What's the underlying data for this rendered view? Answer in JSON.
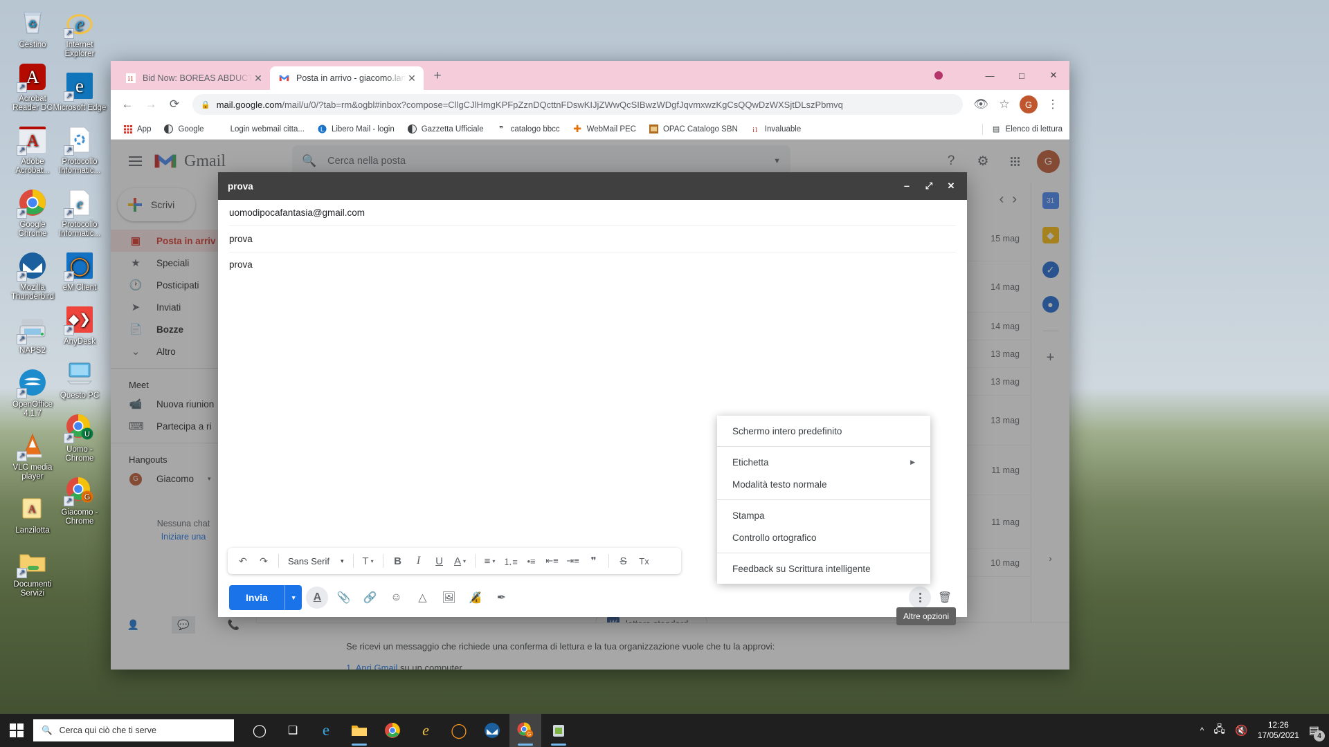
{
  "desktop": {
    "icons": [
      {
        "label": "Cestino",
        "icon": "recycle-bin-icon"
      },
      {
        "label": "Internet Explorer",
        "icon": "internet-explorer-icon"
      },
      {
        "label": "Acrobat Reader DC",
        "icon": "acrobat-reader-icon"
      },
      {
        "label": "Microsoft Edge",
        "icon": "microsoft-edge-icon"
      },
      {
        "label": "Adobe Acrobat...",
        "icon": "adobe-acrobat-icon"
      },
      {
        "label": "Protocollo Informatic...",
        "icon": "document-icon"
      },
      {
        "label": "Google Chrome",
        "icon": "chrome-icon"
      },
      {
        "label": "Protocollo Informatic...",
        "icon": "ie-document-icon"
      },
      {
        "label": "Mozilla Thunderbird",
        "icon": "thunderbird-icon"
      },
      {
        "label": "eM Client",
        "icon": "em-client-icon"
      },
      {
        "label": "NAPS2",
        "icon": "scanner-icon"
      },
      {
        "label": "AnyDesk",
        "icon": "anydesk-icon"
      },
      {
        "label": "OpenOffice 4.1.7",
        "icon": "openoffice-icon"
      },
      {
        "label": "Questo PC",
        "icon": "this-pc-icon"
      },
      {
        "label": "VLC media player",
        "icon": "vlc-icon"
      },
      {
        "label": "Uomo - Chrome",
        "icon": "chrome-profile-uomo-icon"
      },
      {
        "label": "Lanzilotta",
        "icon": "pdf-folder-icon"
      },
      {
        "label": "Giacomo - Chrome",
        "icon": "chrome-profile-giacomo-icon"
      },
      {
        "label": "Documenti Servizi",
        "icon": "folder-icon"
      }
    ]
  },
  "browser": {
    "tabs": [
      {
        "title": "Bid Now: BOREAS ABDUCTING O",
        "favicon": "invaluable-icon",
        "active": false
      },
      {
        "title": "Posta in arrivo - giacomo.lanzilot",
        "favicon": "gmail-icon",
        "active": true
      }
    ],
    "new_tab_label": "+",
    "window_controls": {
      "minimize": "—",
      "maximize": "□",
      "close": "✕"
    },
    "nav": {
      "back": "←",
      "forward": "→",
      "reload": "⟳"
    },
    "omnibox": {
      "lock": "🔒",
      "url_domain": "mail.google.com",
      "url_path": "/mail/u/0/?tab=rm&ogbl#inbox?compose=CllgCJlHmgKPFpZznDQcttnFDswKIJjZWwQcSIBwzWDgfJqvmxwzKgCsQQwDzWXSjtDLszPbmvq"
    },
    "omnibox_actions": {
      "view": "👁",
      "star": "☆",
      "menu": "⋮"
    },
    "profile_letter": "G",
    "bookmarks": [
      {
        "label": "App",
        "icon": "apps-grid-icon"
      },
      {
        "label": "Google",
        "icon": "google-icon"
      },
      {
        "label": "Login webmail citta...",
        "icon": "blank-icon"
      },
      {
        "label": "Libero Mail - login",
        "icon": "libero-icon"
      },
      {
        "label": "Gazzetta Ufficiale",
        "icon": "globe-icon"
      },
      {
        "label": "catalogo bbcc",
        "icon": "quote-icon"
      },
      {
        "label": "WebMail PEC",
        "icon": "pec-icon"
      },
      {
        "label": "OPAC Catalogo SBN",
        "icon": "opac-icon"
      },
      {
        "label": "Invaluable",
        "icon": "invaluable-icon"
      }
    ],
    "reading_list": {
      "label": "Elenco di lettura",
      "icon": "reading-list-icon"
    }
  },
  "gmail": {
    "logo_text": "Gmail",
    "search": {
      "placeholder": "Cerca nella posta",
      "icon": "search-icon",
      "options_icon": "chevron-down-icon"
    },
    "header_actions": [
      {
        "name": "help-icon",
        "glyph": "?"
      },
      {
        "name": "settings-icon",
        "glyph": "⚙"
      },
      {
        "name": "apps-grid-icon",
        "glyph": "grid"
      }
    ],
    "avatar_letter": "G",
    "compose_button": {
      "label": "Scrivi",
      "icon": "plus-icon"
    },
    "nav_items": [
      {
        "label": "Posta in arriv",
        "icon": "inbox-icon",
        "active": true,
        "bold": true
      },
      {
        "label": "Speciali",
        "icon": "star-icon",
        "active": false,
        "bold": false
      },
      {
        "label": "Posticipati",
        "icon": "clock-icon",
        "active": false,
        "bold": false
      },
      {
        "label": "Inviati",
        "icon": "send-icon",
        "active": false,
        "bold": false
      },
      {
        "label": "Bozze",
        "icon": "draft-icon",
        "active": false,
        "bold": true
      },
      {
        "label": "Altro",
        "icon": "chevron-down-icon",
        "active": false,
        "bold": false
      }
    ],
    "sections": [
      {
        "title": "Meet",
        "items": [
          {
            "label": "Nuova riunion",
            "icon": "video-camera-icon"
          },
          {
            "label": "Partecipa a ri",
            "icon": "keyboard-icon"
          }
        ]
      },
      {
        "title": "Hangouts",
        "items": [
          {
            "label": "Giacomo",
            "icon": "avatar-icon"
          }
        ]
      }
    ],
    "chat_empty": {
      "line1": "Nessuna chat",
      "line2": "Iniziare una"
    },
    "pager": {
      "prev": "‹",
      "next": "›"
    },
    "mail_dates": [
      "15 mag",
      "14 mag",
      "14 mag",
      "13 mag",
      "13 mag",
      "13 mag",
      "11 mag",
      "11 mag",
      "10 mag"
    ],
    "right_rail": [
      {
        "name": "calendar-icon",
        "glyph": "31",
        "color": "#4285f4"
      },
      {
        "name": "keep-icon",
        "glyph": "◆",
        "color": "#fbbc04"
      },
      {
        "name": "tasks-icon",
        "glyph": "✓",
        "color": "#1967d2"
      },
      {
        "name": "contacts-icon",
        "glyph": "●",
        "color": "#1967d2"
      },
      {
        "name": "add-addon-icon",
        "glyph": "+",
        "color": "#5f6368"
      }
    ],
    "hangouts_icons": [
      "contacts-icon",
      "chat-icon",
      "phone-icon"
    ],
    "doc_chip": {
      "label": "lettera standard...",
      "icon": "word-doc-icon"
    },
    "body_text": "Se ricevi un messaggio che richiede una conferma di lettura e la tua organizzazione vuole che tu la approvi:",
    "body_step": "1. Apri Gmail",
    "body_step_tail": "su un computer."
  },
  "compose": {
    "title": "prova",
    "window_controls": {
      "minimize": "‒",
      "expand": "⤢",
      "close": "✕"
    },
    "to": "uomodipocafantasia@gmail.com",
    "subject": "prova",
    "body": "prova",
    "toolbar": {
      "undo": "↶",
      "redo": "↷",
      "font_name": "Sans Serif",
      "font_arrow": "▾",
      "font_size": "T",
      "size_arrow": "▾",
      "bold": "B",
      "italic": "I",
      "underline": "U",
      "text_color": "A",
      "color_arrow": "▾",
      "align": "≡",
      "align_arrow": "▾",
      "numbered_list": "list-numbered",
      "bulleted_list": "list-bulleted",
      "indent_less": "indent-less",
      "indent_more": "indent-more",
      "quote": "❞",
      "strikethrough": "S",
      "remove_format": "Tx"
    },
    "send": {
      "label": "Invia",
      "arrow": "▾"
    },
    "footer_icons": [
      {
        "name": "format-text-icon",
        "glyph": "A",
        "selected": true
      },
      {
        "name": "attach-file-icon",
        "glyph": "📎",
        "selected": false
      },
      {
        "name": "insert-link-icon",
        "glyph": "🔗",
        "selected": false
      },
      {
        "name": "insert-emoji-icon",
        "glyph": "☺",
        "selected": false
      },
      {
        "name": "insert-drive-icon",
        "glyph": "△",
        "selected": false
      },
      {
        "name": "insert-photo-icon",
        "glyph": "🖼",
        "selected": false
      },
      {
        "name": "confidential-mode-icon",
        "glyph": "🔒",
        "selected": false
      },
      {
        "name": "insert-signature-icon",
        "glyph": "✒",
        "selected": false
      }
    ],
    "more_options_name": "more-options-icon",
    "discard_icon": "trash-icon",
    "tooltip": "Altre opzioni"
  },
  "context_menu": {
    "groups": [
      [
        {
          "label": "Schermo intero predefinito",
          "submenu": false
        }
      ],
      [
        {
          "label": "Etichetta",
          "submenu": true
        },
        {
          "label": "Modalità testo normale",
          "submenu": false
        }
      ],
      [
        {
          "label": "Stampa",
          "submenu": false
        },
        {
          "label": "Controllo ortografico",
          "submenu": false
        }
      ],
      [
        {
          "label": "Feedback su Scrittura intelligente",
          "submenu": false
        }
      ]
    ],
    "submenu_arrow": "▶"
  },
  "taskbar": {
    "search_placeholder": "Cerca qui ciò che ti serve",
    "search_icon": "search-icon",
    "start_icon": "windows-start-icon",
    "apps": [
      {
        "name": "cortana-icon",
        "glyph": "◯",
        "running": false,
        "active": false
      },
      {
        "name": "task-view-icon",
        "glyph": "❑",
        "running": false,
        "active": false
      },
      {
        "name": "edge-icon",
        "glyph": "e",
        "running": false,
        "active": false
      },
      {
        "name": "file-explorer-icon",
        "glyph": "📁",
        "running": true,
        "active": false
      },
      {
        "name": "chrome-icon",
        "glyph": "chrome",
        "running": false,
        "active": false
      },
      {
        "name": "internet-explorer-icon",
        "glyph": "e",
        "running": false,
        "active": false
      },
      {
        "name": "em-client-icon",
        "glyph": "◯",
        "running": false,
        "active": false
      },
      {
        "name": "thunderbird-icon",
        "glyph": "✉",
        "running": false,
        "active": false
      },
      {
        "name": "chrome-giacomo-icon",
        "glyph": "chrome",
        "running": true,
        "active": true
      },
      {
        "name": "naps2-icon",
        "glyph": "🖨",
        "running": true,
        "active": false
      }
    ],
    "tray": {
      "chevron": "^",
      "network_icon": "network-icon",
      "volume_icon": "volume-muted-icon",
      "time": "12:26",
      "date": "17/05/2021",
      "notification_count": "4"
    }
  }
}
